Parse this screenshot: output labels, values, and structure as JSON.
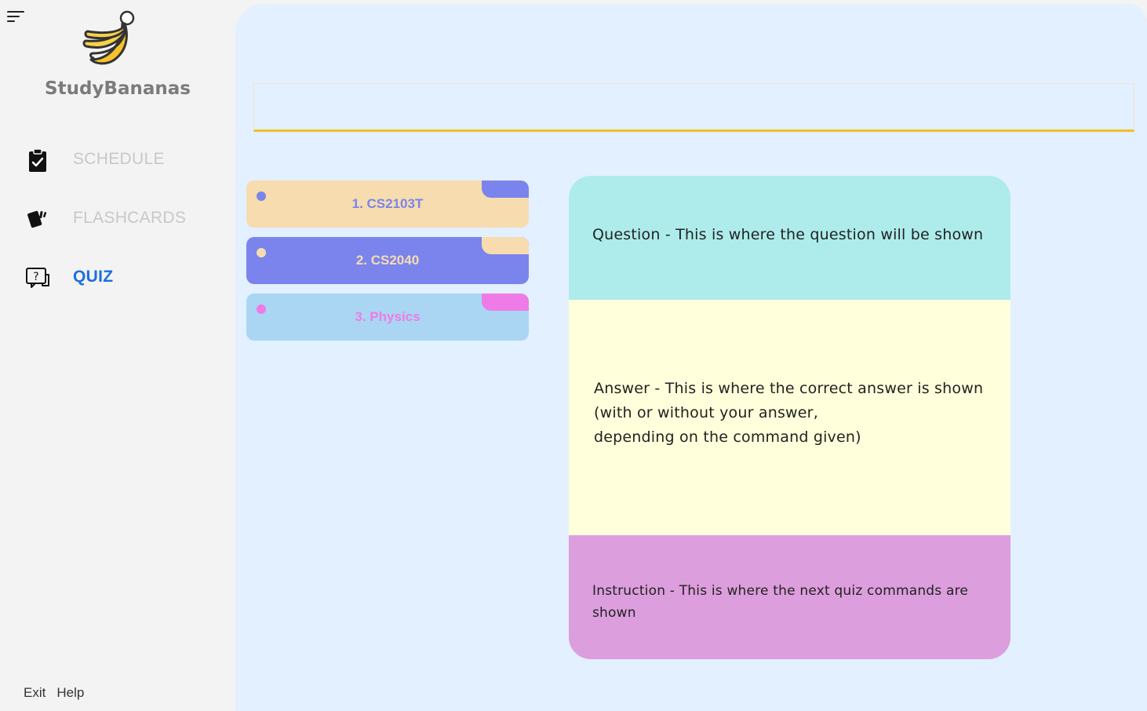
{
  "sidebar": {
    "brand": "StudyBananas",
    "nav": {
      "schedule": {
        "label": "SCHEDULE",
        "icon": "clipboard-check-icon"
      },
      "flashcards": {
        "label": "FLASHCARDS",
        "icon": "cards-icon"
      },
      "quiz": {
        "label": "QUIZ",
        "icon": "quiz-question-icon"
      }
    },
    "footer": {
      "exit": "Exit",
      "help": "Help"
    }
  },
  "command_box": {
    "value": "",
    "placeholder": ""
  },
  "decks": [
    {
      "label": "1. CS2103T",
      "bg": "#f6dcae",
      "tab": "#7b84ec",
      "dot": "#7b84ec",
      "text": "#7b84ec"
    },
    {
      "label": "2. CS2040",
      "bg": "#7b84ec",
      "tab": "#f6dcae",
      "dot": "#f6dcae",
      "text": "#f6dcae"
    },
    {
      "label": "3. Physics",
      "bg": "#aad6f4",
      "tab": "#ef7be6",
      "dot": "#ef7be6",
      "text": "#ef7be6"
    }
  ],
  "quiz_card": {
    "question": "Question - This is where the question will be shown",
    "answer": "Answer - This is where the correct answer is shown\n(with or without your answer,\ndepending on the command given)",
    "instruction": "Instruction - This is where the next quiz commands are shown"
  },
  "colors": {
    "active_nav": "#1a6fe0",
    "accent_underline": "#f0c028",
    "main_bg": "#e3f0ff"
  }
}
